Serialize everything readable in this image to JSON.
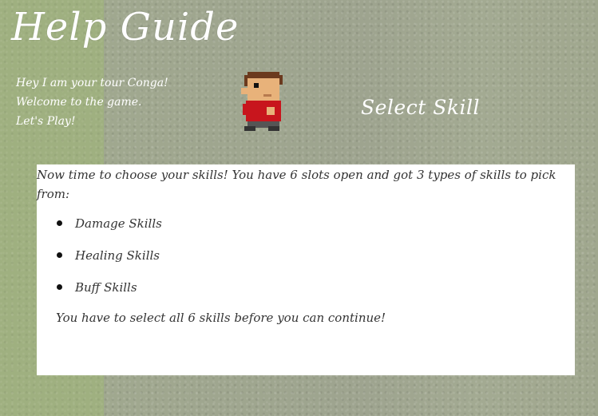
{
  "header": {
    "title": "Help Guide"
  },
  "guide": {
    "intro_lines": [
      "Hey I am your tour Conga!",
      "Welcome to the game.",
      "Let's Play!"
    ],
    "avatar_icon": "pixel-character-icon"
  },
  "section": {
    "title": "Select Skill"
  },
  "panel": {
    "intro": "Now time to choose your skills! You have 6 slots open and got 3 types of skills to pick from:",
    "skills": [
      "Damage Skills",
      "Healing Skills",
      "Buff Skills"
    ],
    "footer": "You have to select all 6 skills before you can continue!"
  }
}
